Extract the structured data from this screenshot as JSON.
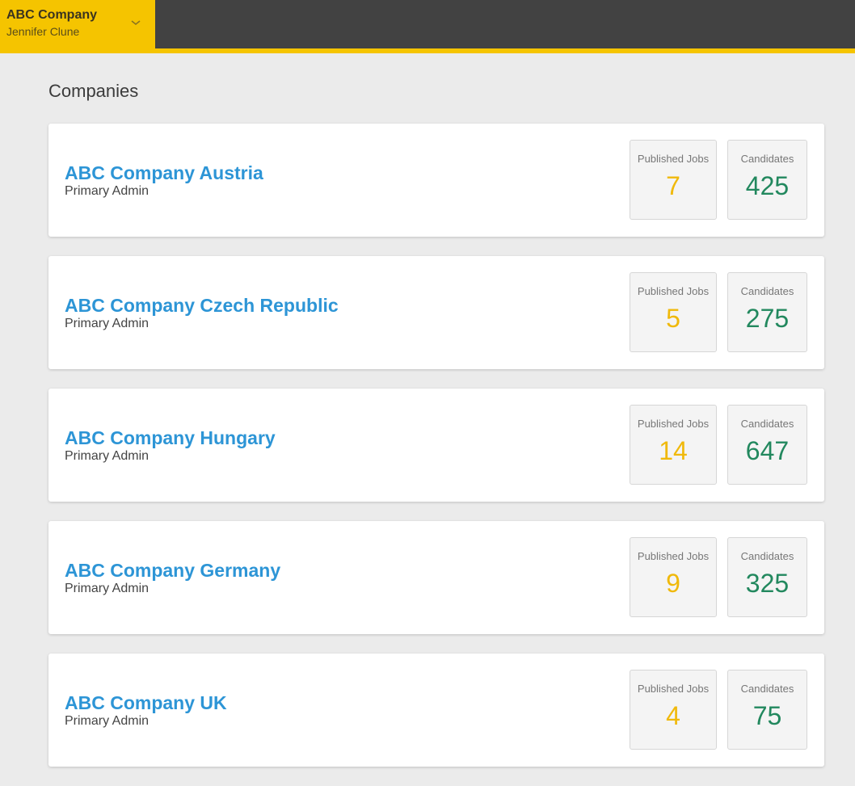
{
  "header": {
    "company": "ABC Company",
    "user": "Jennifer Clune",
    "dropdown_icon": "chevron-down-icon"
  },
  "page_title": "Companies",
  "colors": {
    "brand_yellow": "#f5c400",
    "topbar_dark": "#424242",
    "link_blue": "#2d95d6",
    "jobs_yellow": "#f0b90b",
    "candidates_green": "#22885e"
  },
  "stat_labels": {
    "jobs": "Published Jobs",
    "candidates": "Candidates"
  },
  "companies": [
    {
      "name": "ABC Company Austria",
      "role": "Primary Admin",
      "published_jobs": "7",
      "candidates": "425"
    },
    {
      "name": "ABC Company Czech Republic",
      "role": "Primary Admin",
      "published_jobs": "5",
      "candidates": "275"
    },
    {
      "name": "ABC Company Hungary",
      "role": "Primary Admin",
      "published_jobs": "14",
      "candidates": "647"
    },
    {
      "name": "ABC Company Germany",
      "role": "Primary Admin",
      "published_jobs": "9",
      "candidates": "325"
    },
    {
      "name": "ABC Company UK",
      "role": "Primary Admin",
      "published_jobs": "4",
      "candidates": "75"
    }
  ]
}
